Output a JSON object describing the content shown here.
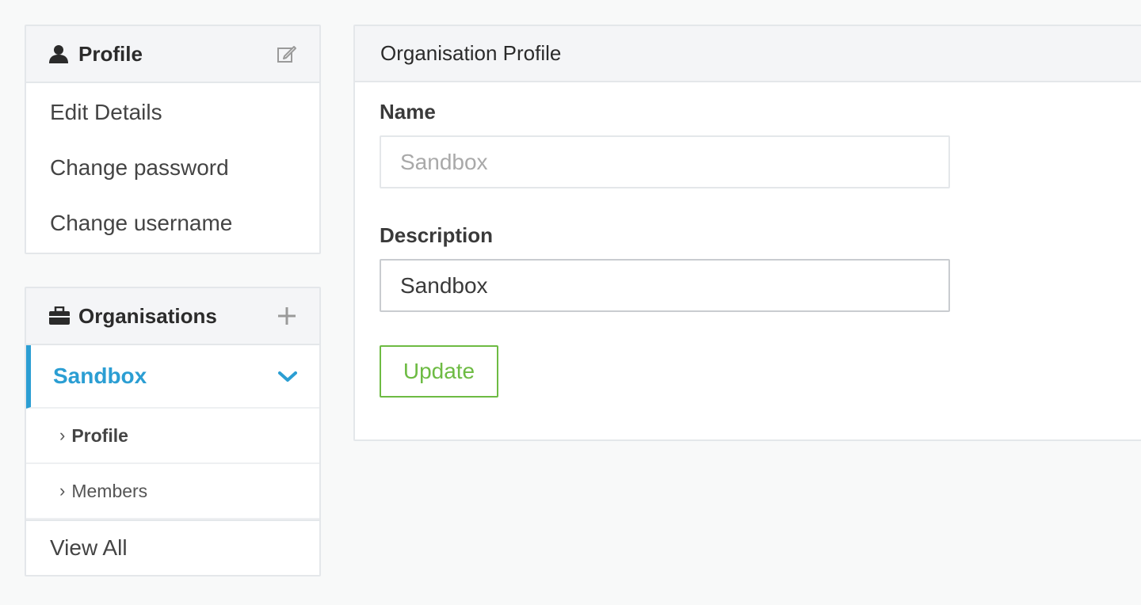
{
  "sidebar": {
    "profile": {
      "title": "Profile",
      "icon": "user-icon",
      "action_icon": "edit-icon",
      "items": [
        {
          "label": "Edit Details"
        },
        {
          "label": "Change password"
        },
        {
          "label": "Change username"
        }
      ]
    },
    "organisations": {
      "title": "Organisations",
      "icon": "briefcase-icon",
      "action_icon": "plus-icon",
      "selected_org": "Sandbox",
      "sub_items": [
        {
          "label": "Profile",
          "active": true
        },
        {
          "label": "Members",
          "active": false
        }
      ],
      "view_all": "View All"
    }
  },
  "main": {
    "title": "Organisation Profile",
    "name_label": "Name",
    "name_value": "Sandbox",
    "description_label": "Description",
    "description_value": "Sandbox",
    "update_label": "Update"
  },
  "colors": {
    "accent_blue": "#2b9ed3",
    "button_green": "#6dbb43",
    "border": "#e4e7ea",
    "header_bg": "#f4f5f7"
  }
}
